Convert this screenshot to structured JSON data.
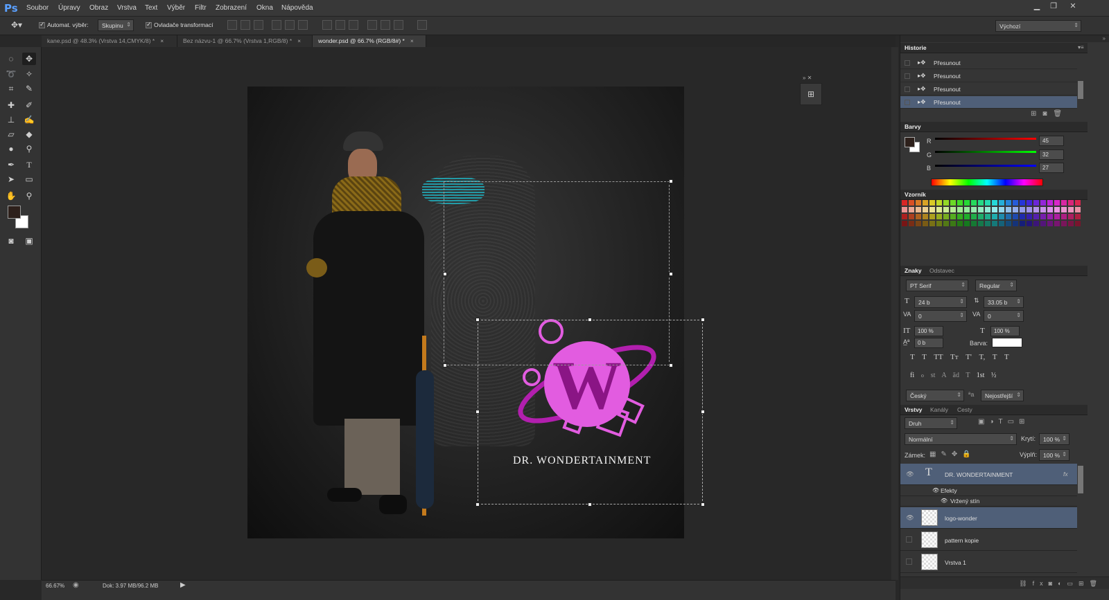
{
  "app": {
    "logo": "Ps"
  },
  "menu": [
    "Soubor",
    "Úpravy",
    "Obraz",
    "Vrstva",
    "Text",
    "Výběr",
    "Filtr",
    "Zobrazení",
    "Okna",
    "Nápověda"
  ],
  "options": {
    "auto_select_label": "Automat. výběr:",
    "auto_select_value": "Skupinu",
    "transform_label": "Ovladače transformací",
    "workspace": "Výchozí"
  },
  "tabs": [
    {
      "label": "kane.psd @ 48.3% (Vrstva 14,CMYK/8) *"
    },
    {
      "label": "Bez názvu-1 @ 66.7% (Vrstva 1,RGB/8) *"
    },
    {
      "label": "wonder.psd @ 66.7% (RGB/8#) *"
    }
  ],
  "canvas": {
    "logo_letter": "W",
    "logo_text": "DR. WONDERTAINMENT"
  },
  "status": {
    "zoom": "66.67%",
    "doc": "Dok: 3.97 MB/96.2 MB"
  },
  "history": {
    "title": "Historie",
    "items": [
      "Přesunout",
      "Přesunout",
      "Přesunout",
      "Přesunout"
    ]
  },
  "color": {
    "title": "Barvy",
    "r_label": "R",
    "g_label": "G",
    "b_label": "B",
    "r": "45",
    "g": "32",
    "b": "27"
  },
  "swatches": {
    "title": "Vzorník"
  },
  "character": {
    "tab1": "Znaky",
    "tab2": "Odstavec",
    "font": "PT Serif",
    "style": "Regular",
    "size": "24 b",
    "leading": "33.05 b",
    "kerning": "0",
    "tracking": "0",
    "vscale": "100 %",
    "hscale": "100 %",
    "baseline": "0 b",
    "color_label": "Barva:",
    "typestyles": [
      "T",
      "T",
      "TT",
      "Tт",
      "T'",
      "T,",
      "T",
      "T"
    ],
    "opentype": [
      "fi",
      "ℴ",
      "st",
      "A",
      "ād",
      "T",
      "1st",
      "½"
    ],
    "language": "Český",
    "aa": "Nejostřejší"
  },
  "layers": {
    "tabs": [
      "Vrstvy",
      "Kanály",
      "Cesty"
    ],
    "filter": "Druh",
    "blend": "Normální",
    "opacity_label": "Krytí:",
    "opacity": "100 %",
    "lock_label": "Zámek:",
    "fill_label": "Výplň:",
    "fill": "100 %",
    "items": [
      {
        "name": "DR. WONDERTAINMENT",
        "effects": "Efekty",
        "effect": "Vržený stín"
      },
      {
        "name": "logo-wonder"
      },
      {
        "name": "pattern kopie"
      },
      {
        "name": "Vrstva 1"
      }
    ]
  }
}
